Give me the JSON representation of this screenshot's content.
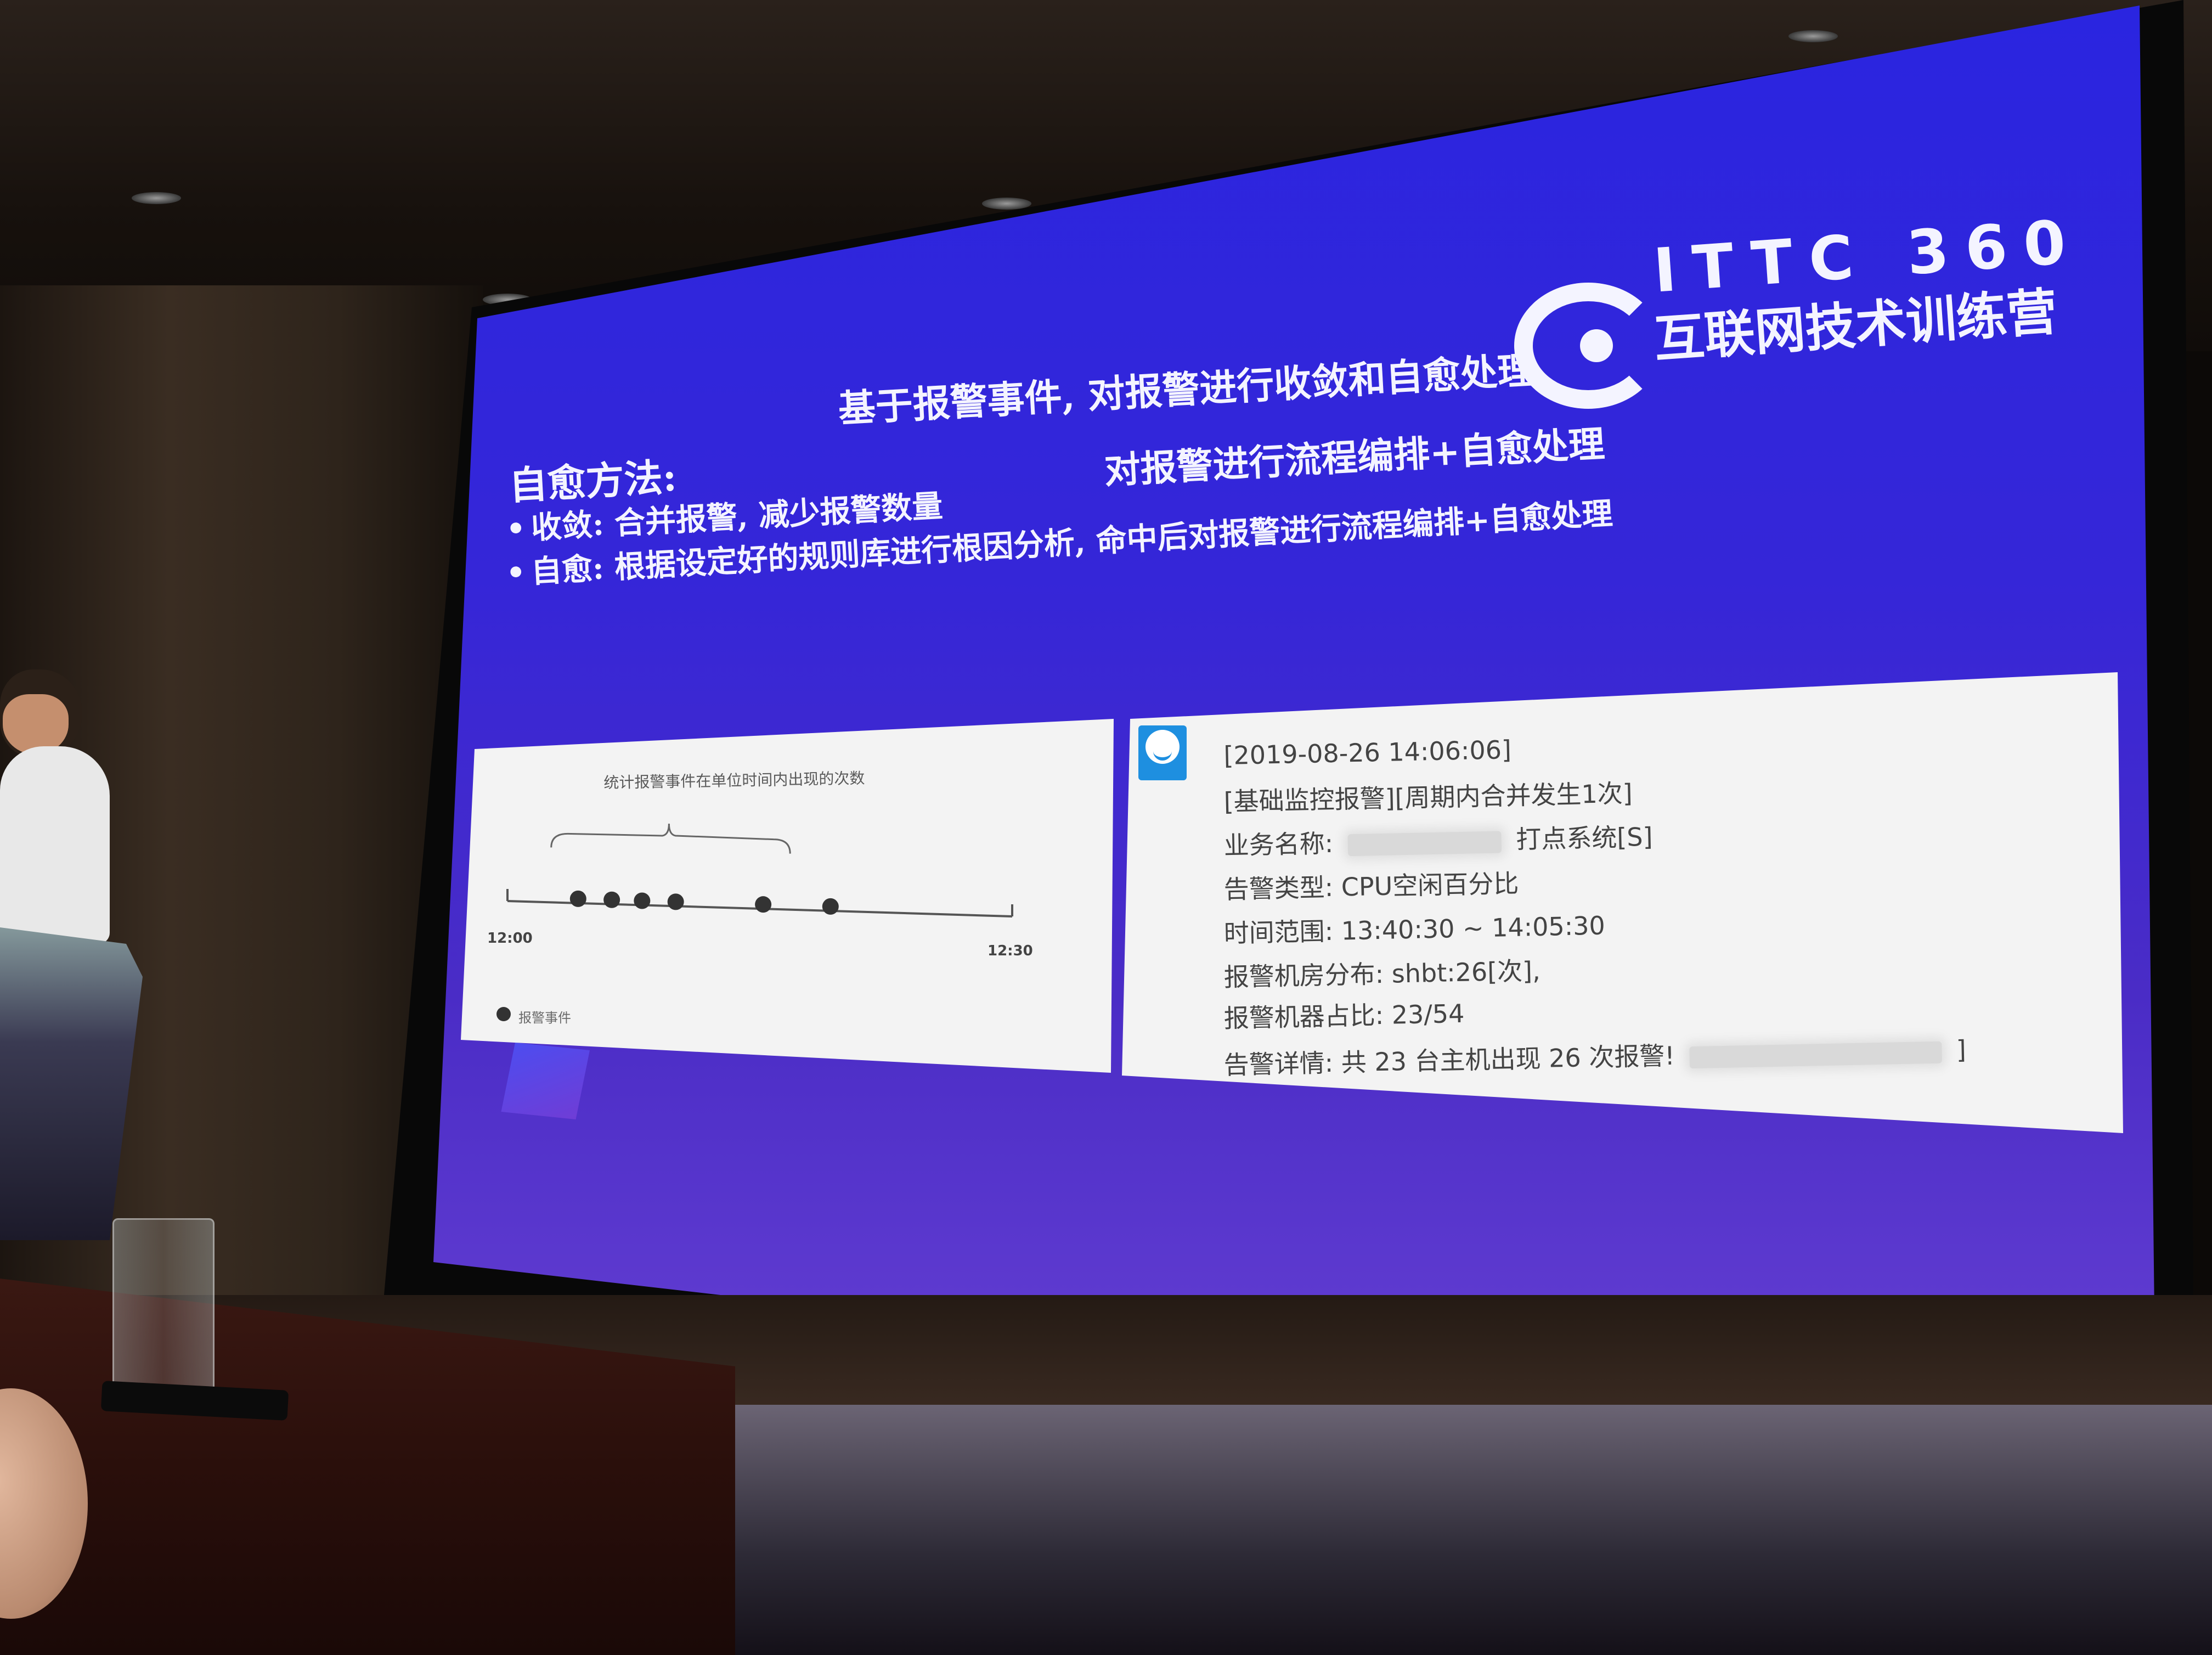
{
  "logo": {
    "title": "ITTC 360",
    "subtitle": "互联网技术训练营"
  },
  "slide": {
    "title": "基于报警事件, 对报警进行收敛和自愈处理",
    "method_lead": "自愈方法:",
    "method_text": "对报警进行流程编排+自愈处理",
    "bullets": [
      "收敛: 合并报警, 减少报警数量",
      "自愈: 根据设定好的规则库进行根因分析, 命中后对报警进行流程编排+自愈处理"
    ]
  },
  "chart_data": {
    "type": "scatter",
    "title": "统计报警事件在单位时间内出现的次数",
    "x_start_label": "12:00",
    "x_end_label": "12:30",
    "xlim": [
      0,
      30
    ],
    "points": [
      4.2,
      6.2,
      8.0,
      10.0,
      15.2,
      19.2
    ],
    "legend": "报警事件"
  },
  "message": {
    "timestamp": "[2019-08-26 14:06:06]",
    "header": "[基础监控报警][周期内合并发生1次]",
    "business_label": "业务名称:",
    "business_value": "打点系统[S]",
    "type_line": "告警类型: CPU空闲百分比",
    "range_line": "时间范围: 13:40:30 ~ 14:05:30",
    "room_line": "报警机房分布: shbt:26[次],",
    "ratio_line": "报警机器占比: 23/54",
    "detail_line": "告警详情: 共 23 台主机出现 26 次报警!",
    "detail_tail": "]"
  }
}
